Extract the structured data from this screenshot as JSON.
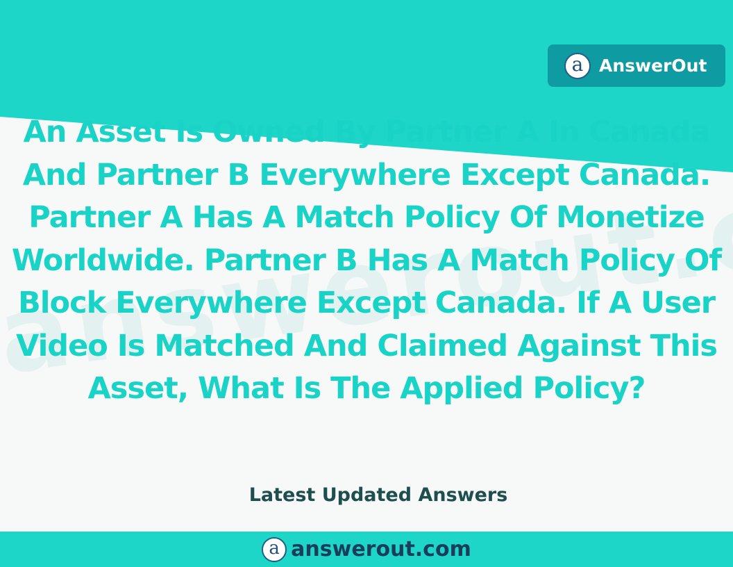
{
  "brand": {
    "name": "AnswerOut",
    "logo_glyph": "a",
    "badge_color": "#0f9ba2"
  },
  "question": {
    "text": "An Asset Is Owned By Partner A In Canada And Partner B Everywhere Except Canada. Partner A Has A Match Policy Of Monetize Worldwide. Partner B Has A Match Policy Of Block Everywhere Except Canada. If A User Video Is Matched And Claimed Against This Asset, What Is The Applied Policy?",
    "color": "#18d3c6"
  },
  "tagline": "Latest Updated Answers",
  "footer": {
    "url": "answerout.com",
    "logo_glyph": "a",
    "color": "#1dd6c8"
  },
  "watermark": "answerout.com"
}
